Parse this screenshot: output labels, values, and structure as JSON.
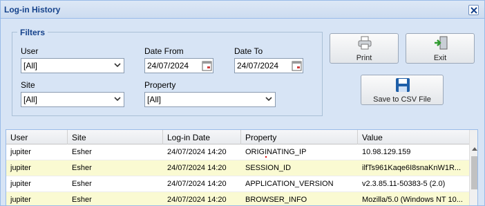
{
  "window": {
    "title": "Log-in History",
    "close_icon": "close-icon"
  },
  "filters": {
    "legend": "Filters",
    "user_label": "User",
    "user_value": "[All]",
    "date_from_label": "Date From",
    "date_from_value": "24/07/2024",
    "date_to_label": "Date To",
    "date_to_value": "24/07/2024",
    "site_label": "Site",
    "site_value": "[All]",
    "property_label": "Property",
    "property_value": "[All]"
  },
  "buttons": {
    "print_label": "Print",
    "exit_label": "Exit",
    "csv_label": "Save to CSV File"
  },
  "grid": {
    "columns": [
      "User",
      "Site",
      "Log-in Date",
      "Property",
      "Value"
    ],
    "rows": [
      [
        "jupiter",
        "Esher",
        "24/07/2024 14:20",
        "ORIGINATING_IP",
        "10.98.129.159"
      ],
      [
        "jupiter",
        "Esher",
        "24/07/2024 14:20",
        "SESSION_ID",
        "ilfTs961Kaqe6I8snaKnW1R..."
      ],
      [
        "jupiter",
        "Esher",
        "24/07/2024 14:20",
        "APPLICATION_VERSION",
        "v2.3.85.11-50383-5 (2.0)"
      ],
      [
        "jupiter",
        "Esher",
        "24/07/2024 14:20",
        "BROWSER_INFO",
        "Mozilla/5.0 (Windows NT 10..."
      ]
    ]
  },
  "colors": {
    "title_text": "#15428b",
    "window_bg": "#d7e4f5",
    "alt_row": "#fafad2"
  }
}
